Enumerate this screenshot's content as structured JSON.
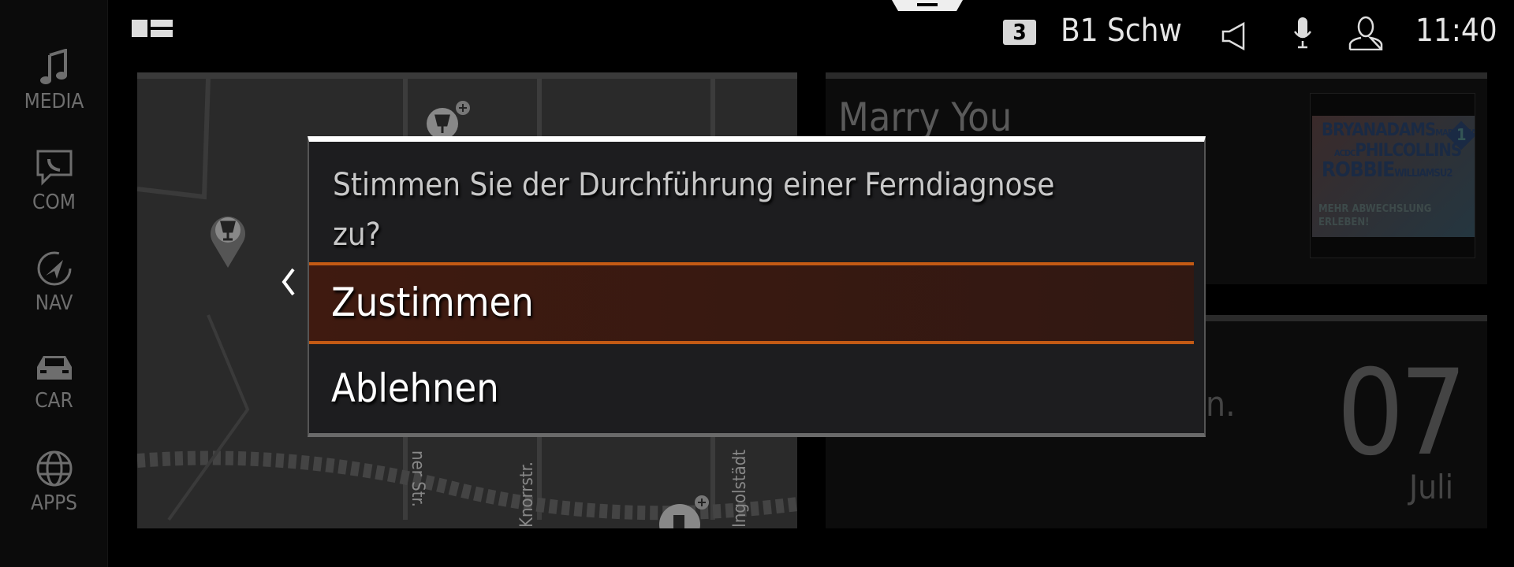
{
  "sidebar": {
    "items": [
      {
        "label": "MEDIA",
        "icon": "music-note-icon"
      },
      {
        "label": "COM",
        "icon": "phone-message-icon"
      },
      {
        "label": "NAV",
        "icon": "navigation-icon"
      },
      {
        "label": "CAR",
        "icon": "car-icon"
      },
      {
        "label": "APPS",
        "icon": "globe-icon"
      }
    ]
  },
  "status_bar": {
    "badge": "3",
    "station": "B1 Schw",
    "time": "11:40",
    "icons": [
      "split-view-icon",
      "speaker-icon",
      "microphone-icon",
      "user-icon"
    ]
  },
  "map": {
    "streets": [
      "ner Str.",
      "Knorrstr.",
      "Ingolstädt"
    ]
  },
  "media": {
    "title": "Marry You",
    "album_art": {
      "line1": "BRYANADAMS",
      "line1b": "MADONNA",
      "line2a": "ACDC",
      "line2": "PHILCOLLINS",
      "line3": "ROBBIE",
      "line3b": "WILLIAMSU2",
      "badge": "1",
      "slogan1": "MEHR ABWECHSLUNG",
      "slogan2": "ERLEBEN!"
    }
  },
  "calendar": {
    "day": "07",
    "month": "Juli",
    "partial_text": "n."
  },
  "dialog": {
    "question_line1": "Stimmen Sie der Durchführung einer Ferndiagnose",
    "question_line2": "zu?",
    "options": [
      "Zustimmen",
      "Ablehnen"
    ],
    "accent": "#c35a14"
  }
}
